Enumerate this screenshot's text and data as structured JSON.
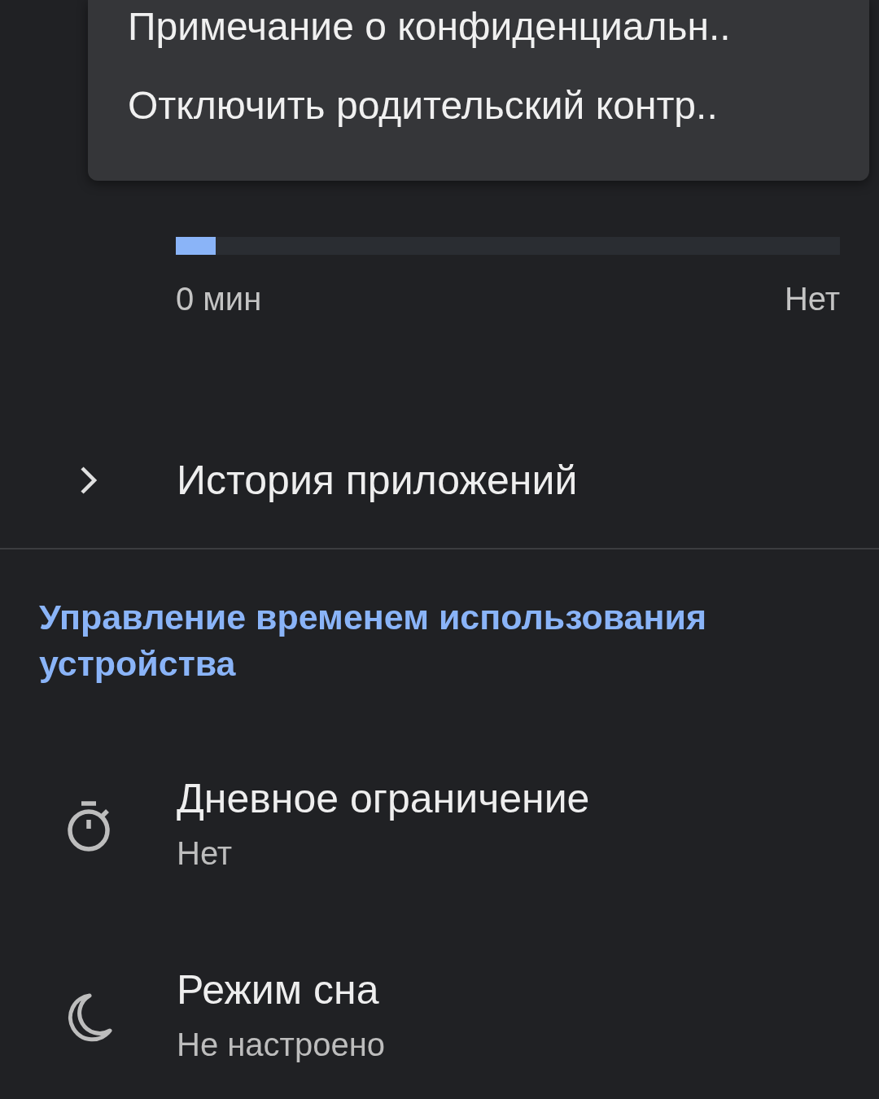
{
  "menu": {
    "items": [
      {
        "label": "Примечание о конфиденциальн.."
      },
      {
        "label": "Отключить родительский контр.."
      }
    ]
  },
  "usage": {
    "level": 0.06,
    "start_label": "0 мин",
    "end_label": "Нет"
  },
  "app_history": {
    "label": "История приложений",
    "expanded": false
  },
  "section": {
    "title": "Управление временем использования устройства"
  },
  "settings": [
    {
      "kind": "timer",
      "title": "Дневное ограничение",
      "subtitle": "Нет"
    },
    {
      "kind": "bedtime",
      "title": "Режим сна",
      "subtitle": "Не настроено"
    }
  ]
}
